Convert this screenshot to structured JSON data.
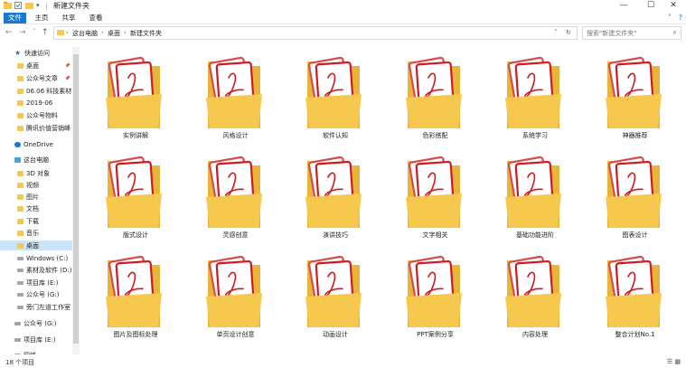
{
  "window": {
    "title": "新建文件夹",
    "minimize": "—",
    "maximize": "☐",
    "close": "✕"
  },
  "ribbon": {
    "tabs": [
      "文件",
      "主页",
      "共享",
      "查看"
    ],
    "expand": "˅",
    "help": "?"
  },
  "address": {
    "breadcrumbs": [
      "这台电脑",
      "桌面",
      "新建文件夹"
    ],
    "search_placeholder": "搜索\"新建文件夹\""
  },
  "sidebar": {
    "items": [
      {
        "label": "快速访问",
        "icon": "star-icon",
        "pinned": false
      },
      {
        "label": "桌面",
        "icon": "folder-icon",
        "pinned": true
      },
      {
        "label": "公众号文章",
        "icon": "folder-icon",
        "pinned": true
      },
      {
        "label": "06.06 科技素材",
        "icon": "folder-icon",
        "pinned": false
      },
      {
        "label": "2019-06",
        "icon": "folder-icon",
        "pinned": false
      },
      {
        "label": "公众号物料",
        "icon": "folder-icon",
        "pinned": false
      },
      {
        "label": "腾讯价值营销峰",
        "icon": "folder-icon",
        "pinned": false
      },
      {
        "label": "OneDrive",
        "icon": "cloud-icon",
        "pinned": false
      },
      {
        "label": "这台电脑",
        "icon": "pc-icon",
        "pinned": false
      },
      {
        "label": "3D 对象",
        "icon": "folder-icon",
        "pinned": false
      },
      {
        "label": "视频",
        "icon": "folder-icon",
        "pinned": false
      },
      {
        "label": "图片",
        "icon": "folder-icon",
        "pinned": false
      },
      {
        "label": "文档",
        "icon": "folder-icon",
        "pinned": false
      },
      {
        "label": "下载",
        "icon": "folder-icon",
        "pinned": false
      },
      {
        "label": "音乐",
        "icon": "folder-icon",
        "pinned": false
      },
      {
        "label": "桌面",
        "icon": "folder-icon",
        "pinned": false,
        "selected": true
      },
      {
        "label": "Windows (C:)",
        "icon": "drive-icon",
        "pinned": false
      },
      {
        "label": "素材及软件 (D:)",
        "icon": "drive-icon",
        "pinned": false
      },
      {
        "label": "项目库 (E:)",
        "icon": "drive-icon",
        "pinned": false
      },
      {
        "label": "公众号 (G:)",
        "icon": "drive-icon",
        "pinned": false
      },
      {
        "label": "旁门左道工作室",
        "icon": "drive-icon",
        "pinned": false
      },
      {
        "label": "公众号 (G:)",
        "icon": "drive-icon",
        "pinned": false
      },
      {
        "label": "项目库 (E:)",
        "icon": "drive-icon",
        "pinned": false
      },
      {
        "label": "网络",
        "icon": "network-icon",
        "pinned": false
      }
    ]
  },
  "folders": [
    "实例讲解",
    "风格设计",
    "软件认知",
    "色彩搭配",
    "系统学习",
    "神器推荐",
    "版式设计",
    "灵感创意",
    "演讲技巧",
    "文字相关",
    "基础功能进阶",
    "图表设计",
    "图片及图标处理",
    "单页设计创意",
    "动画设计",
    "PPT案例分享",
    "内容处理",
    "整合计划No.1"
  ],
  "status": {
    "count": "18 个项目"
  },
  "colors": {
    "accent": "#1979ca",
    "folder": "#f6c94e",
    "pdf_red": "#d0191f",
    "selection": "#cce4f7"
  }
}
